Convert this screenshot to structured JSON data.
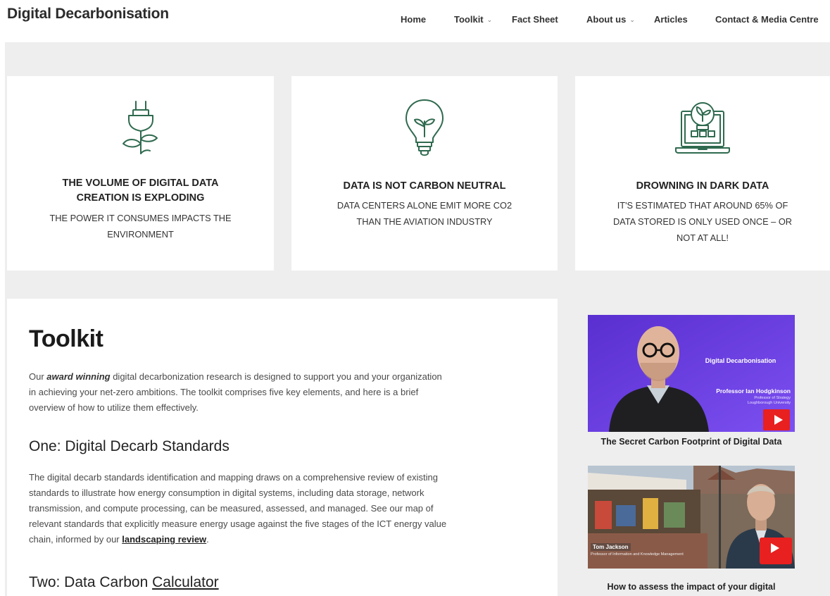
{
  "site": {
    "title": "Digital Decarbonisation"
  },
  "nav": {
    "items": [
      {
        "label": "Home",
        "has_dropdown": false
      },
      {
        "label": "Toolkit",
        "has_dropdown": true
      },
      {
        "label": "Fact Sheet",
        "has_dropdown": false
      },
      {
        "label": "About us",
        "has_dropdown": true
      },
      {
        "label": "Articles",
        "has_dropdown": false
      },
      {
        "label": "Contact & Media Centre",
        "has_dropdown": false
      }
    ]
  },
  "cards": [
    {
      "icon": "plug-plant-icon",
      "title_line1": "THE VOLUME OF DIGITAL DATA",
      "title_line2": "CREATION IS EXPLODING",
      "sub_line1": "THE POWER IT CONSUMES IMPACTS THE",
      "sub_line2": "ENVIRONMENT",
      "sub_line3": ""
    },
    {
      "icon": "lightbulb-plant-icon",
      "title_line1": "DATA IS NOT CARBON NEUTRAL",
      "title_line2": "",
      "sub_line1": "DATA CENTERS ALONE EMIT MORE CO2",
      "sub_line2": "THAN THE AVIATION INDUSTRY",
      "sub_line3": ""
    },
    {
      "icon": "laptop-plant-icon",
      "title_line1": "DROWNING IN DARK DATA",
      "title_line2": "",
      "sub_line1": "IT'S ESTIMATED THAT AROUND 65% OF",
      "sub_line2": "DATA STORED IS ONLY USED ONCE – OR",
      "sub_line3": "NOT AT ALL!"
    }
  ],
  "toolkit": {
    "heading": "Toolkit",
    "intro": {
      "prefix": "Our ",
      "emphasis": "award winning",
      "line1_rest": " digital decarbonization research is designed to support you and your organization",
      "line2": "in achieving your net-zero ambitions. The toolkit comprises five key elements, and here is a brief",
      "line3": "overview of how to utilize them effectively."
    },
    "section1": {
      "heading": "One: Digital Decarb Standards",
      "line1": "The digital decarb standards identification and mapping draws on a comprehensive review of existing",
      "line2": "standards to illustrate how energy consumption in digital systems, including data storage, network",
      "line3": "transmission, and compute processing, can be measured, assessed, and managed. See our map of",
      "line4": "relevant standards that explicitly measure energy usage against the five stages of the ICT energy value",
      "line5_prefix": "chain, informed by our ",
      "line5_link": "landscaping review",
      "line5_suffix": "."
    },
    "section2": {
      "heading_prefix": "Two: Data Carbon ",
      "heading_link": "Calculator"
    }
  },
  "videos": [
    {
      "overlay_title": "Digital Decarbonisation",
      "presenter": "Professor Ian Hodgkinson",
      "role1": "Professor of Strategy",
      "role2": "Loughborough University",
      "caption": "The Secret Carbon Footprint of Digital Data"
    },
    {
      "overlay_name": "Tom Jackson",
      "overlay_role": "Professor of Information and Knowledge Management",
      "caption": "How to assess the impact of your digital"
    }
  ],
  "colors": {
    "icon_green": "#2f6a4f",
    "band_grey": "#eeeeee",
    "video_purple": "#6a3fd8",
    "play_red": "#e8201f"
  }
}
